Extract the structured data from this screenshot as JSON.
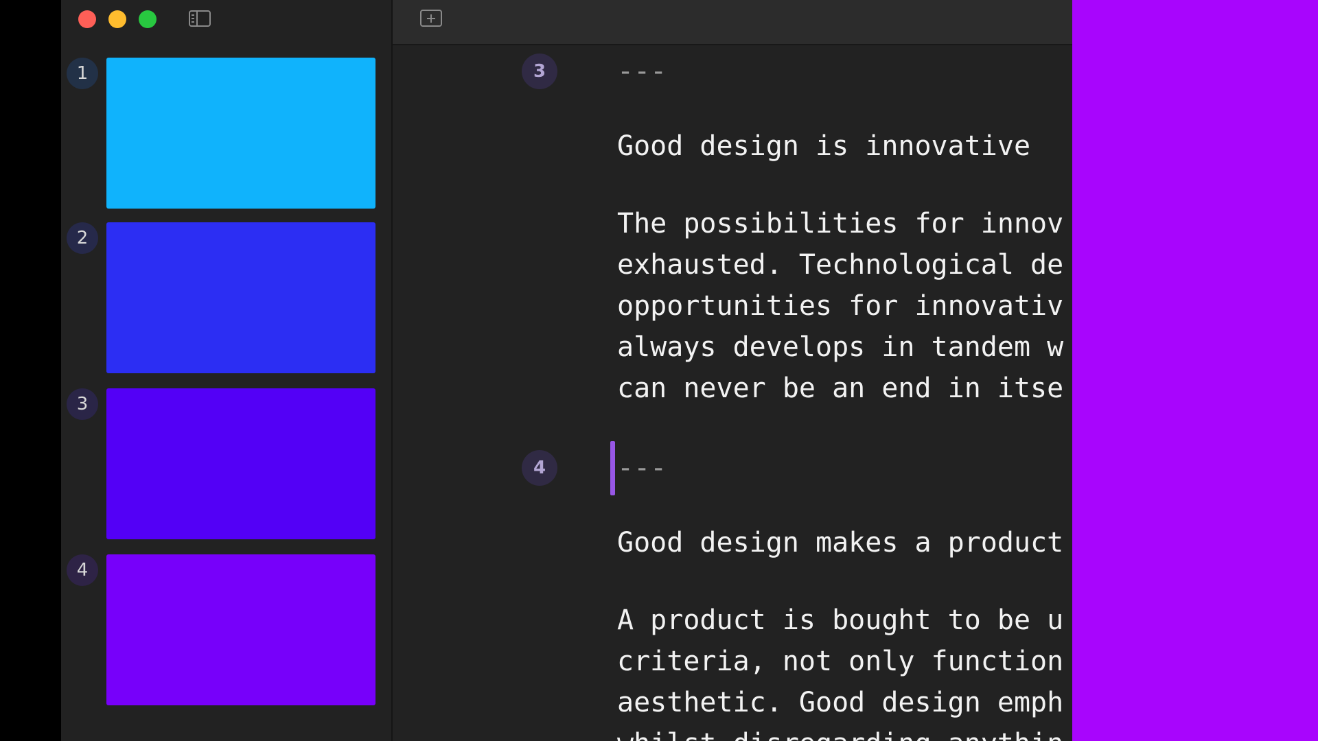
{
  "colors": {
    "window_bg": "#222222",
    "preview_panel": "#a805fd",
    "cursor": "#9757e6"
  },
  "window_controls": {
    "close": "close-button",
    "minimize": "minimize-button",
    "maximize": "maximize-button"
  },
  "toolbar": {
    "sidebar_toggle_icon": "sidebar-icon",
    "add_slide_icon": "plus-square-icon"
  },
  "sidebar": {
    "slides": [
      {
        "number": "1",
        "color": "#10b3fc"
      },
      {
        "number": "2",
        "color": "#2c2ef3"
      },
      {
        "number": "3",
        "color": "#5300f6"
      },
      {
        "number": "4",
        "color": "#7700fa"
      }
    ]
  },
  "editor": {
    "markers": [
      "3",
      "4"
    ],
    "lines": [
      "---",
      "Good design is innovative",
      "The possibilities for innov",
      "exhausted. Technological de",
      "opportunities for innovativ",
      "always develops in tandem w",
      "can never be an end in itse",
      "---",
      "Good design makes a product",
      "A product is bought to be u",
      "criteria, not only function",
      "aesthetic. Good design emph",
      "whilst disregarding anythin"
    ]
  }
}
